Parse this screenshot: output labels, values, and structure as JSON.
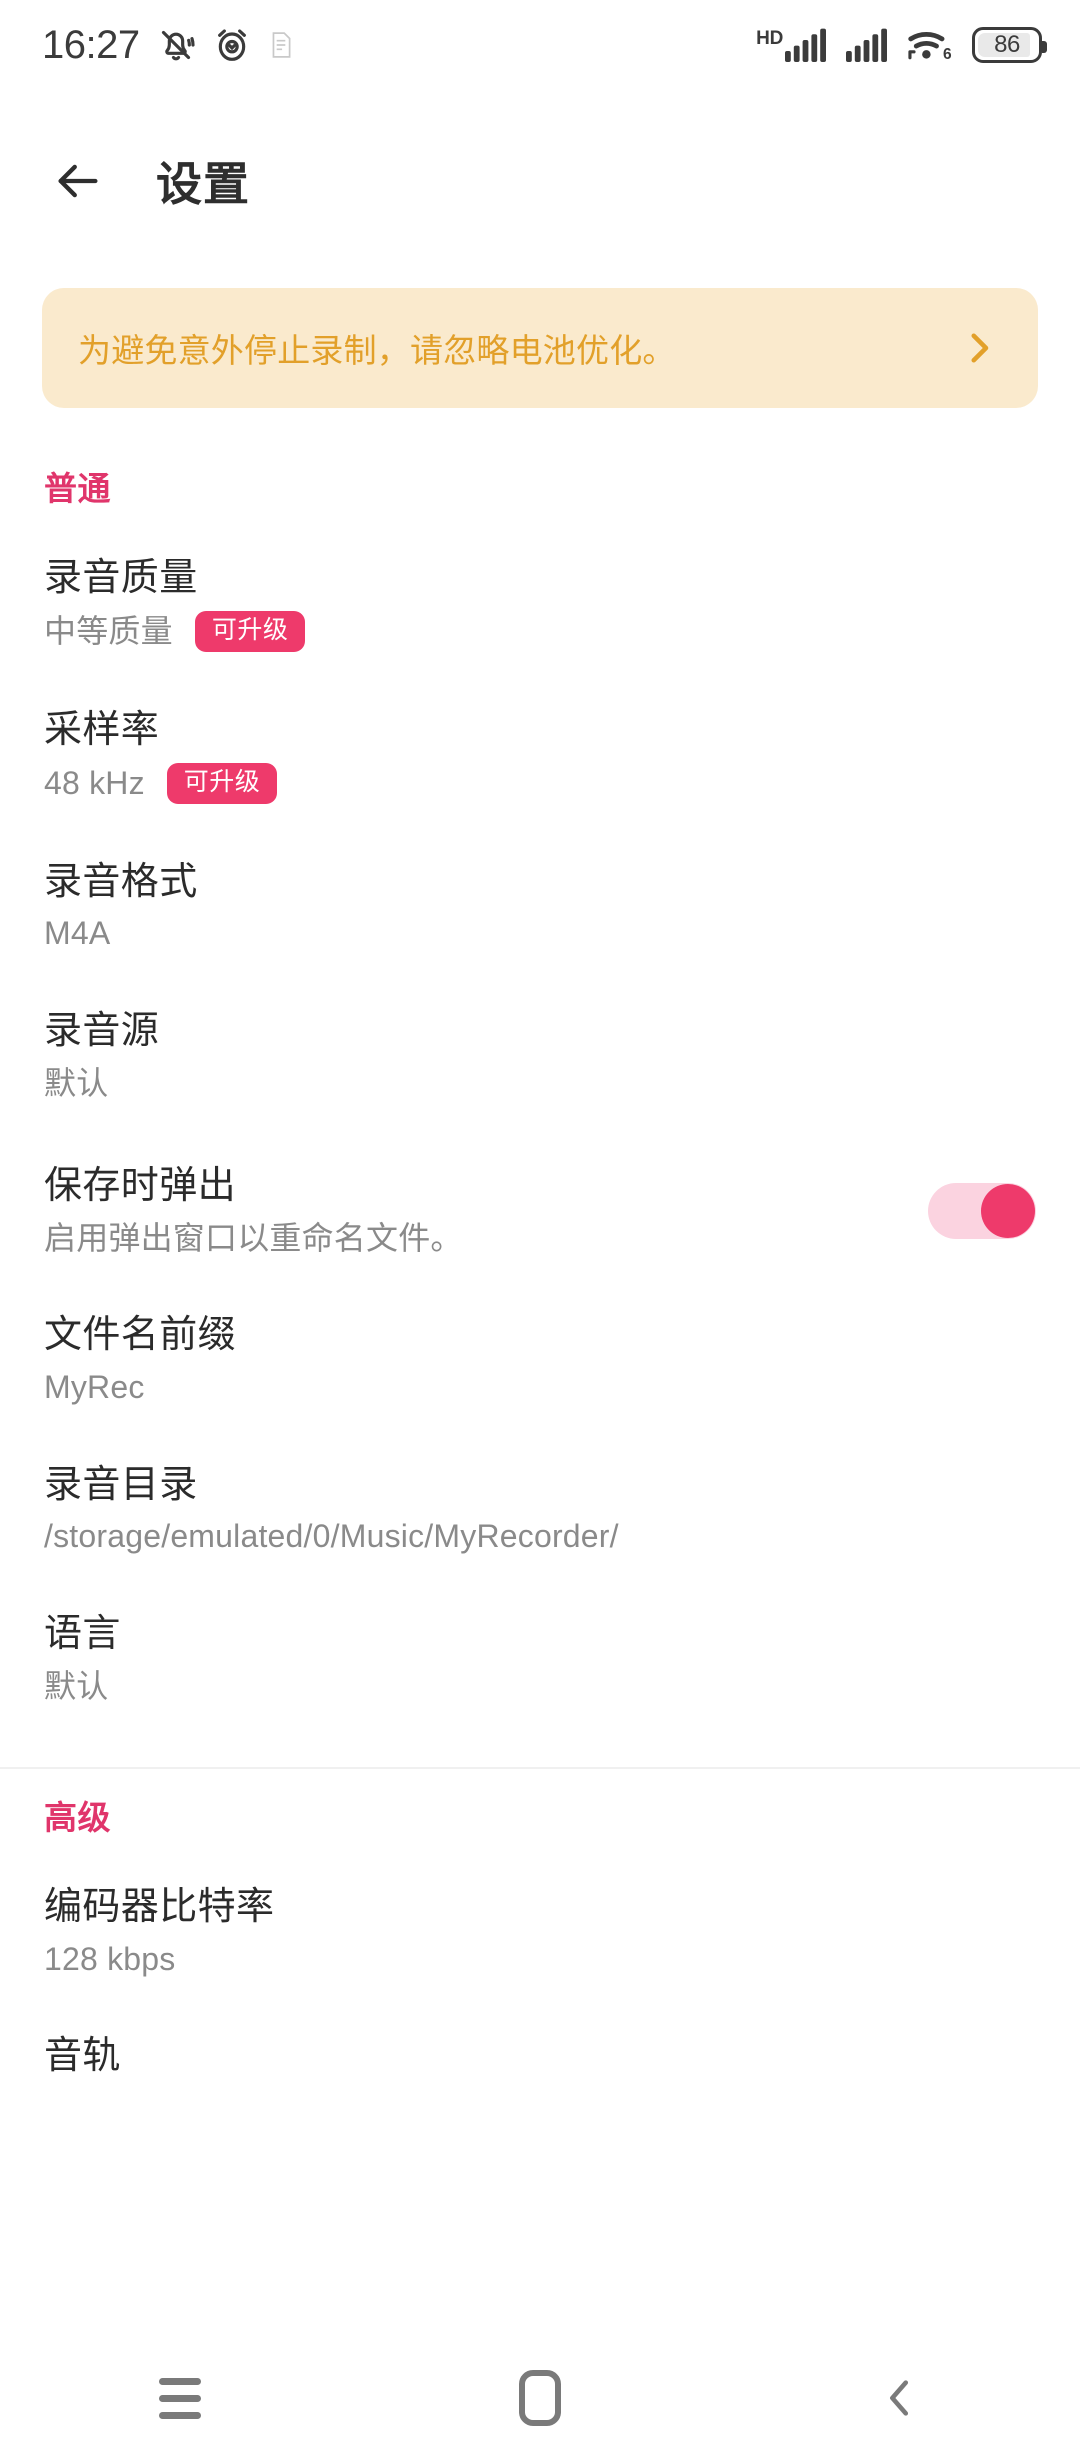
{
  "status_bar": {
    "clock": "16:27",
    "mute_icon": "bell-muted-icon",
    "alarm_icon": "alarm-clock-icon",
    "extra_icon": "unknown-small-icon",
    "hd_label": "HD",
    "signal1_icon": "cellular-signal-icon",
    "signal2_icon": "cellular-signal-icon",
    "wifi_icon": "wifi-icon",
    "wifi_generation": "6",
    "battery_level": "86"
  },
  "app_bar": {
    "back_icon": "arrow-left-icon",
    "title": "设置"
  },
  "banner": {
    "text": "为避免意外停止录制，请忽略电池优化。",
    "chevron_icon": "chevron-right-icon",
    "bg_color": "#faeacd",
    "text_color": "#e2a02a"
  },
  "accent_color": "#ee3a6b",
  "sections": [
    {
      "header": "普通",
      "items": [
        {
          "title": "录音质量",
          "sub": "中等质量",
          "badge": "可升级"
        },
        {
          "title": "采样率",
          "sub": "48 kHz",
          "badge": "可升级"
        },
        {
          "title": "录音格式",
          "sub": "M4A"
        },
        {
          "title": "录音源",
          "sub": "默认"
        },
        {
          "title": "保存时弹出",
          "sub": "启用弹出窗口以重命名文件。",
          "toggle": "on"
        },
        {
          "title": "文件名前缀",
          "sub": "MyRec"
        },
        {
          "title": "录音目录",
          "sub": "/storage/emulated/0/Music/MyRecorder/"
        },
        {
          "title": "语言",
          "sub": "默认"
        }
      ]
    },
    {
      "header": "高级",
      "items": [
        {
          "title": "编码器比特率",
          "sub": "128 kbps"
        },
        {
          "title": "音轨"
        }
      ]
    }
  ],
  "nav_bar": {
    "recents_icon": "recents-menu-icon",
    "home_icon": "home-square-icon",
    "back_icon": "back-chevron-icon"
  }
}
